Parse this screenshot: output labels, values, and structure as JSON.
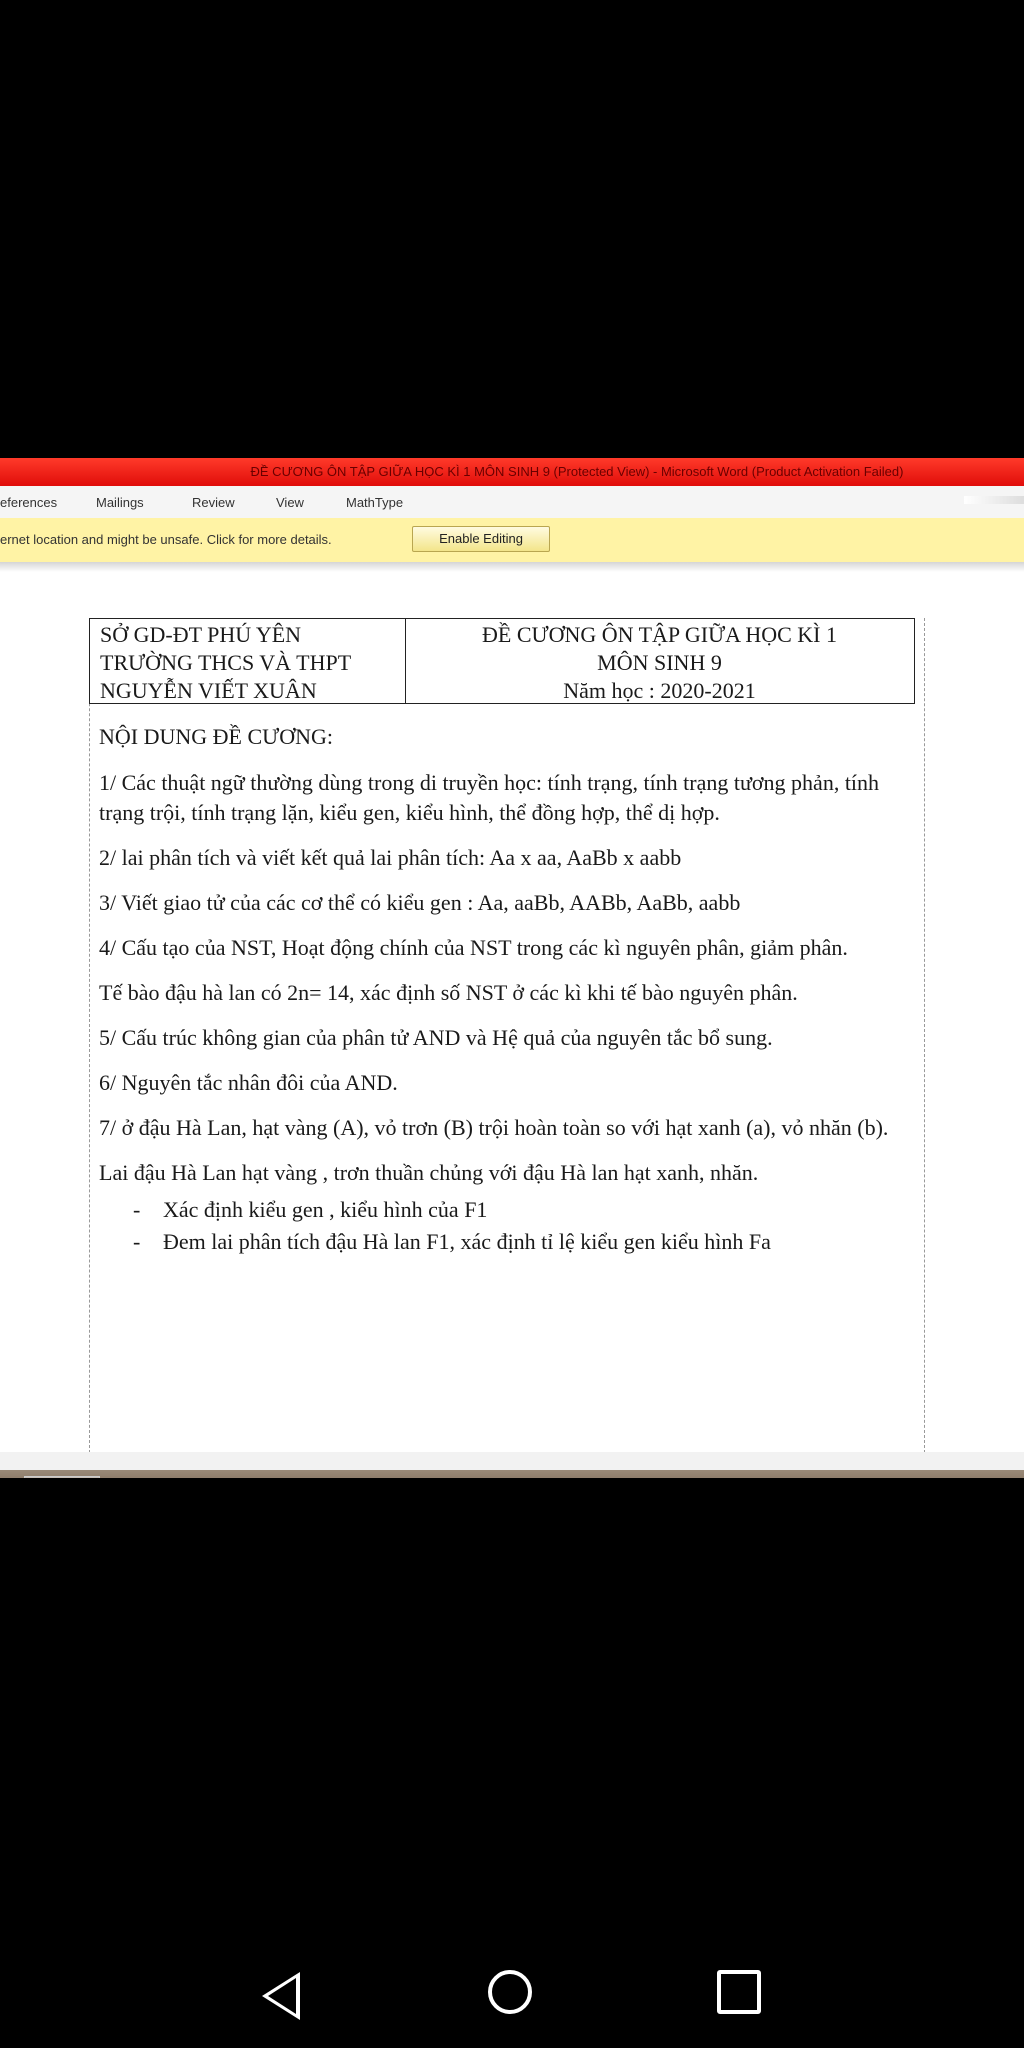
{
  "window": {
    "title": "ĐỀ CƯƠNG ÔN TẬP GIỮA HỌC KÌ 1 MÔN SINH 9 (Protected View) - Microsoft Word (Product Activation Failed)"
  },
  "ribbon": {
    "tabs": [
      "eferences",
      "Mailings",
      "Review",
      "View",
      "MathType"
    ]
  },
  "message_bar": {
    "text": "ernet location and might be unsafe. Click for more details.",
    "button": "Enable Editing"
  },
  "document": {
    "header_left": [
      "SỞ GD-ĐT PHÚ YÊN",
      "TRƯỜNG THCS VÀ THPT",
      "NGUYỄN VIẾT XUÂN"
    ],
    "header_right": [
      "ĐỀ CƯƠNG ÔN TẬP GIỮA HỌC KÌ 1",
      "MÔN SINH 9",
      "Năm học : 2020-2021"
    ],
    "heading": "NỘI DUNG ĐỀ CƯƠNG:",
    "paragraphs": [
      "1/ Các thuật ngữ thường dùng trong di truyền học: tính trạng, tính trạng tương phản, tính trạng trội, tính trạng lặn, kiểu gen, kiểu hình, thể đồng hợp, thể dị hợp.",
      "2/ lai phân tích và viết kết quả lai phân tích: Aa x aa, AaBb x aabb",
      "3/ Viết giao tử của các cơ thể có kiểu gen : Aa, aaBb, AABb, AaBb, aabb",
      "4/ Cấu tạo của NST, Hoạt động chính của NST trong các kì nguyên phân, giảm phân.",
      "Tế bào đậu hà lan có 2n= 14, xác định số NST ở các kì khi tế bào nguyên phân.",
      "5/ Cấu trúc không gian của phân tử AND và Hệ quả của nguyên tắc bổ sung.",
      "6/ Nguyên tắc nhân đôi của AND.",
      "7/ ở đậu Hà Lan, hạt vàng (A), vỏ trơn (B) trội hoàn toàn so với hạt xanh (a), vỏ nhăn (b).",
      "Lai đậu Hà Lan hạt vàng , trơn thuần chủng với đậu Hà lan hạt xanh, nhăn."
    ],
    "bullets": [
      "Xác định kiểu gen , kiểu hình của F1",
      "Đem lai phân tích đậu Hà lan F1, xác định tỉ lệ kiểu gen kiểu hình Fa"
    ]
  },
  "taskbar": {
    "icons": [
      "word-icon",
      "media-icon",
      "green-app-icon"
    ]
  },
  "navbar": {
    "icons": [
      "back-icon",
      "home-icon",
      "recents-icon"
    ]
  }
}
